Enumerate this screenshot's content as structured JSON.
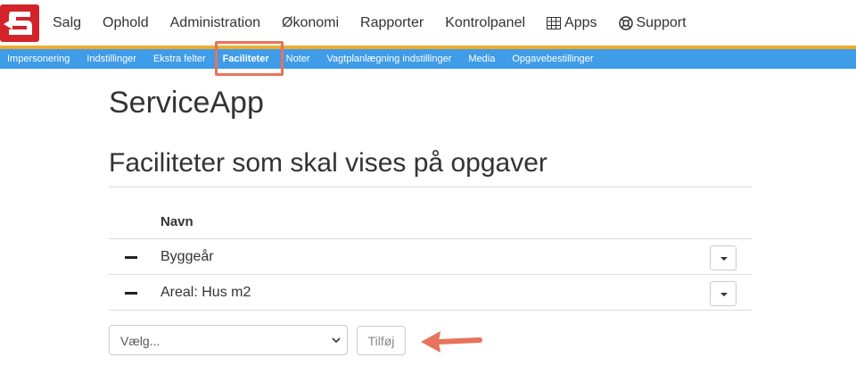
{
  "top_nav": {
    "items": [
      {
        "label": "Salg"
      },
      {
        "label": "Ophold"
      },
      {
        "label": "Administration"
      },
      {
        "label": "Økonomi"
      },
      {
        "label": "Rapporter"
      },
      {
        "label": "Kontrolpanel"
      },
      {
        "label": "Apps",
        "icon": "grid-icon"
      },
      {
        "label": "Support",
        "icon": "lifebuoy-icon"
      }
    ]
  },
  "sub_nav": {
    "items": [
      {
        "label": "Impersonering"
      },
      {
        "label": "Indstillinger"
      },
      {
        "label": "Ekstra felter"
      },
      {
        "label": "Faciliteter",
        "active": true
      },
      {
        "label": "Noter"
      },
      {
        "label": "Vagtplanlægning indstillinger"
      },
      {
        "label": "Media"
      },
      {
        "label": "Opgavebestillinger"
      }
    ]
  },
  "page": {
    "title": "ServiceApp",
    "section_title": "Faciliteter som skal vises på opgaver"
  },
  "table": {
    "header": "Navn",
    "rows": [
      {
        "name": "Byggeår"
      },
      {
        "name": "Areal: Hus m2"
      }
    ]
  },
  "add_form": {
    "select_value": "Vælg...",
    "add_button": "Tilføj"
  },
  "colors": {
    "logo_red": "#d2232a",
    "accent": "#f0ad2b",
    "subnav": "#3f9ce8",
    "highlight": "#e7735d"
  }
}
